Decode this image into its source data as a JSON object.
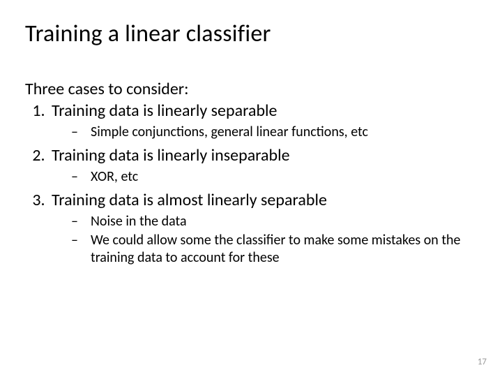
{
  "title": "Training a linear classifier",
  "lead": "Three cases to consider:",
  "items": [
    {
      "text": "Training data is linearly separable",
      "sub": [
        "Simple conjunctions, general linear functions, etc"
      ]
    },
    {
      "text": "Training data is linearly inseparable",
      "sub": [
        "XOR, etc"
      ]
    },
    {
      "text": "Training data is almost linearly separable",
      "sub": [
        "Noise in the data",
        "We could allow some the classifier to make some mistakes on the training data to account for these"
      ]
    }
  ],
  "page_number": "17"
}
